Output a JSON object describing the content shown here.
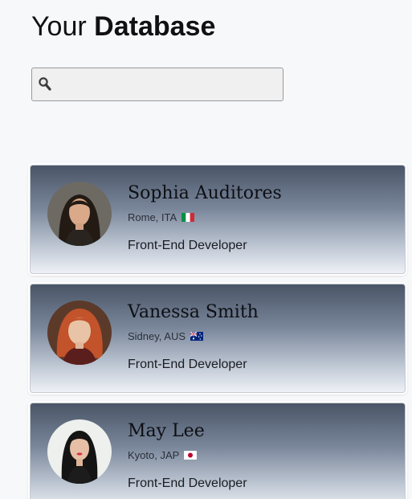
{
  "header": {
    "title_light": "Your",
    "title_bold": "Database"
  },
  "search": {
    "icon": "search-icon",
    "value": "",
    "placeholder": ""
  },
  "cards": [
    {
      "name": "Sophia Auditores",
      "location": "Rome, ITA",
      "flag": "italy-flag",
      "role": "Front-End Developer"
    },
    {
      "name": "Vanessa Smith",
      "location": "Sidney, AUS",
      "flag": "australia-flag",
      "role": "Front-End Developer"
    },
    {
      "name": "May Lee",
      "location": "Kyoto, JAP",
      "flag": "japan-flag",
      "role": "Front-End Developer"
    }
  ]
}
